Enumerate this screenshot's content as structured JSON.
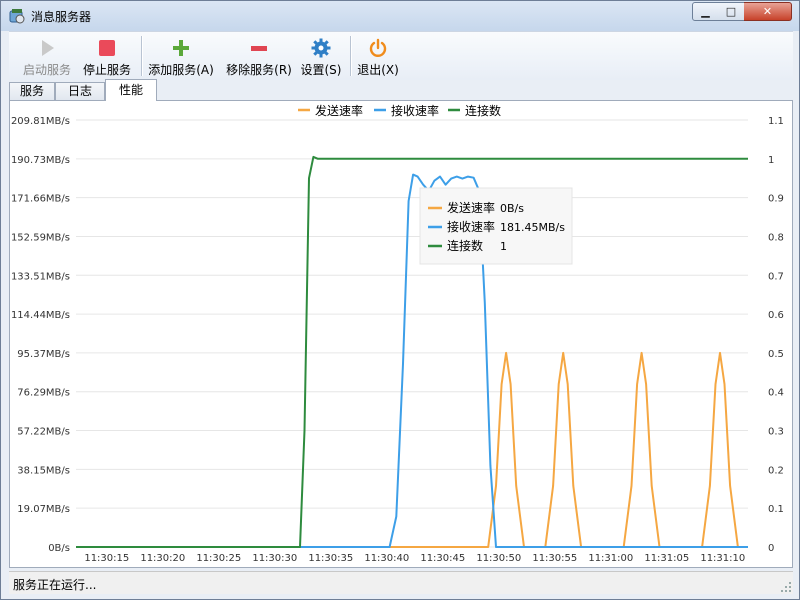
{
  "window": {
    "title": "消息服务器",
    "minimize_icon": "minimize-icon",
    "maximize_icon": "maximize-icon",
    "close_icon": "close-icon"
  },
  "toolbar": {
    "buttons": [
      {
        "label": "启动服务",
        "icon": "play-icon",
        "enabled": false
      },
      {
        "label": "停止服务",
        "icon": "stop-icon",
        "enabled": true
      },
      {
        "label": "添加服务(A)",
        "icon": "plus-icon",
        "enabled": true
      },
      {
        "label": "移除服务(R)",
        "icon": "minus-icon",
        "enabled": true
      },
      {
        "label": "设置(S)",
        "icon": "gear-icon",
        "enabled": true
      },
      {
        "label": "退出(X)",
        "icon": "power-icon",
        "enabled": true
      }
    ]
  },
  "tabs": [
    {
      "label": "服务",
      "active": false
    },
    {
      "label": "日志",
      "active": false
    },
    {
      "label": "性能",
      "active": true
    }
  ],
  "tooltip": {
    "rows": [
      {
        "name": "发送速率",
        "value": "0B/s"
      },
      {
        "name": "接收速率",
        "value": "181.45MB/s"
      },
      {
        "name": "连接数",
        "value": "1"
      }
    ]
  },
  "status": {
    "text": "服务正在运行..."
  },
  "chart_data": {
    "type": "line",
    "legend_position": "top-center",
    "grid": true,
    "y_left_ticks": [
      "0B/s",
      "19.07MB/s",
      "38.15MB/s",
      "57.22MB/s",
      "76.29MB/s",
      "95.37MB/s",
      "114.44MB/s",
      "133.51MB/s",
      "152.59MB/s",
      "171.66MB/s",
      "190.73MB/s",
      "209.81MB/s"
    ],
    "y_right_ticks": [
      "0",
      "0.1",
      "0.2",
      "0.3",
      "0.4",
      "0.5",
      "0.6",
      "0.7",
      "0.8",
      "0.9",
      "1",
      "1.1"
    ],
    "x_ticks": [
      "11:30:15",
      "11:30:20",
      "11:30:25",
      "11:30:30",
      "11:30:35",
      "11:30:40",
      "11:30:45",
      "11:30:50",
      "11:30:55",
      "11:31:00",
      "11:31:05",
      "11:31:10"
    ],
    "x_range": [
      0,
      60
    ],
    "ylim_left_mb": [
      0,
      209.81
    ],
    "ylim_right": [
      0,
      1.1
    ],
    "series": [
      {
        "name": "发送速率",
        "color": "#f5a742",
        "axis": "left",
        "points": [
          [
            0,
            0
          ],
          [
            36.8,
            0
          ],
          [
            37.5,
            30
          ],
          [
            38.0,
            80
          ],
          [
            38.4,
            95.37
          ],
          [
            38.8,
            80
          ],
          [
            39.3,
            30
          ],
          [
            40.0,
            0
          ],
          [
            41.9,
            0
          ],
          [
            42.6,
            30
          ],
          [
            43.1,
            80
          ],
          [
            43.5,
            95.37
          ],
          [
            43.9,
            80
          ],
          [
            44.4,
            30
          ],
          [
            45.1,
            0
          ],
          [
            48.9,
            0
          ],
          [
            49.6,
            30
          ],
          [
            50.1,
            80
          ],
          [
            50.5,
            95.37
          ],
          [
            50.9,
            80
          ],
          [
            51.4,
            30
          ],
          [
            52.1,
            0
          ],
          [
            55.9,
            0
          ],
          [
            56.6,
            30
          ],
          [
            57.1,
            80
          ],
          [
            57.5,
            95.37
          ],
          [
            57.9,
            80
          ],
          [
            58.4,
            30
          ],
          [
            59.1,
            0
          ]
        ]
      },
      {
        "name": "接收速率",
        "color": "#3d9fe8",
        "axis": "left",
        "points": [
          [
            0,
            0
          ],
          [
            28.0,
            0
          ],
          [
            28.6,
            15
          ],
          [
            29.2,
            90
          ],
          [
            29.7,
            170
          ],
          [
            30.1,
            183
          ],
          [
            30.5,
            182
          ],
          [
            31.0,
            178
          ],
          [
            31.5,
            175
          ],
          [
            32.0,
            180
          ],
          [
            32.5,
            182
          ],
          [
            33.0,
            178
          ],
          [
            33.5,
            181
          ],
          [
            34.0,
            182
          ],
          [
            34.5,
            181
          ],
          [
            35.0,
            182
          ],
          [
            35.5,
            181.45
          ],
          [
            36.0,
            175
          ],
          [
            36.5,
            120
          ],
          [
            37.0,
            40
          ],
          [
            37.5,
            0
          ],
          [
            60,
            0
          ]
        ]
      },
      {
        "name": "连接数",
        "color": "#2e8b3e",
        "axis": "right",
        "points": [
          [
            0,
            0
          ],
          [
            20.0,
            0
          ],
          [
            20.4,
            0.3
          ],
          [
            20.8,
            0.95
          ],
          [
            21.2,
            1.005
          ],
          [
            21.6,
            1
          ],
          [
            60,
            1
          ]
        ]
      }
    ],
    "tooltip_values": {
      "发送速率": "0B/s",
      "接收速率": "181.45MB/s",
      "连接数": "1"
    }
  }
}
